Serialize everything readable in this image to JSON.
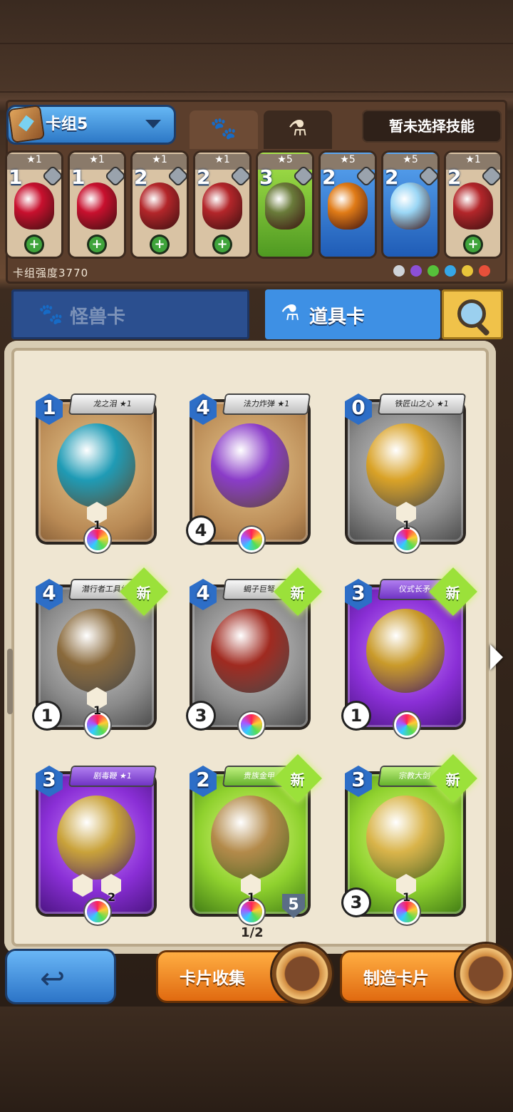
{
  "deck": {
    "name": "卡组5",
    "skill_text": "暂未选择技能",
    "power_label": "卡组强度3770",
    "tabs": [
      {
        "icon": "paw-icon"
      },
      {
        "icon": "potion-icon"
      }
    ],
    "slots": [
      {
        "stars": "★1",
        "cost": "1",
        "art": "red-potion",
        "color": "#c8102e",
        "frame": "tan"
      },
      {
        "stars": "★1",
        "cost": "1",
        "art": "red-potion",
        "color": "#c8102e",
        "frame": "tan"
      },
      {
        "stars": "★1",
        "cost": "2",
        "art": "blood-vial-amulet",
        "color": "#b3262a",
        "frame": "tan"
      },
      {
        "stars": "★1",
        "cost": "2",
        "art": "blood-vial-amulet",
        "color": "#b3262a",
        "frame": "tan"
      },
      {
        "stars": "★5",
        "cost": "3",
        "art": "flintlock-pistol",
        "color": "#6a7b3a",
        "frame": "green"
      },
      {
        "stars": "★5",
        "cost": "2",
        "art": "orange-shield",
        "color": "#e07b17",
        "frame": "blue"
      },
      {
        "stars": "★5",
        "cost": "2",
        "art": "ice-dress",
        "color": "#9ad6f5",
        "frame": "blue"
      },
      {
        "stars": "★1",
        "cost": "2",
        "art": "red-book",
        "color": "#b3262a",
        "frame": "tan"
      }
    ],
    "type_icons": [
      "gray",
      "purple",
      "green",
      "blue",
      "yellow",
      "red"
    ]
  },
  "category_tabs": {
    "monster": "怪兽卡",
    "item": "道具卡"
  },
  "cards": [
    {
      "name": "龙之泪 ★1",
      "cost": "1",
      "frame": "tan",
      "banner": "white",
      "art": "teal-egg",
      "art_color": "#1f9bb5",
      "is_new": false,
      "stats": [
        "1"
      ],
      "extra": ""
    },
    {
      "name": "法力炸弹 ★1",
      "cost": "4",
      "frame": "tan",
      "banner": "white",
      "art": "purple-bomb",
      "art_color": "#8a3cc8",
      "is_new": false,
      "stats": [],
      "extra": "4"
    },
    {
      "name": "铁匠山之心 ★1",
      "cost": "0",
      "frame": "gray",
      "banner": "white",
      "art": "gold-medallion",
      "art_color": "#d9a227",
      "is_new": false,
      "stats": [
        "1"
      ],
      "extra": ""
    },
    {
      "name": "潜行者工具组 ★1",
      "cost": "4",
      "frame": "gray",
      "banner": "white",
      "art": "rope-tools",
      "art_color": "#8a6a3c",
      "is_new": true,
      "stats": [
        "1"
      ],
      "extra": "1"
    },
    {
      "name": "蝎子巨弩 ★1",
      "cost": "4",
      "frame": "gray",
      "banner": "white",
      "art": "crossbow",
      "art_color": "#a02a20",
      "is_new": true,
      "stats": [],
      "extra": "3"
    },
    {
      "name": "仪式长矛 ★1",
      "cost": "3",
      "frame": "purple",
      "banner": "purple",
      "art": "trident",
      "art_color": "#c99a2a",
      "is_new": true,
      "stats": [],
      "extra": "1"
    },
    {
      "name": "剧毒鞭 ★1",
      "cost": "3",
      "frame": "purple",
      "banner": "purple",
      "art": "poison-whip",
      "art_color": "#c9a23a",
      "is_new": false,
      "stats": [
        "",
        "2"
      ],
      "extra": ""
    },
    {
      "name": "贵族金甲 ★1",
      "cost": "2",
      "frame": "green",
      "banner": "green",
      "art": "gold-armor",
      "art_color": "#b38a4a",
      "is_new": true,
      "stats": [
        "1"
      ],
      "extra": "",
      "shield": "5"
    },
    {
      "name": "宗教大剑 ★1",
      "cost": "3",
      "frame": "green",
      "banner": "green",
      "art": "holy-sword",
      "art_color": "#d9b44a",
      "is_new": true,
      "stats": [
        "1"
      ],
      "extra": "3"
    }
  ],
  "new_label": "新",
  "card_count": "1/2",
  "buttons": {
    "collect": "卡片收集",
    "craft": "制造卡片"
  }
}
